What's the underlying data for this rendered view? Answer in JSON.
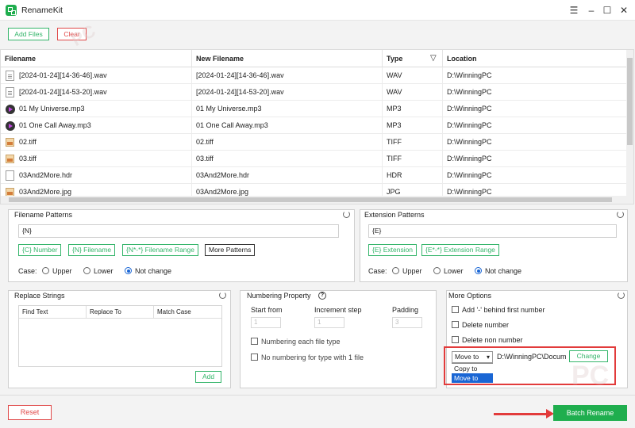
{
  "app": {
    "title": "RenameKit"
  },
  "toolbar": {
    "add_files": "Add Files",
    "clear": "Clear"
  },
  "table": {
    "columns": [
      "Filename",
      "New Filename",
      "Type",
      "Location"
    ],
    "rows": [
      {
        "filename": "[2024-01-24][14-36-46].wav",
        "new": "[2024-01-24][14-36-46].wav",
        "type": "WAV",
        "location": "D:\\WinningPC",
        "icon": "document-icon"
      },
      {
        "filename": "[2024-01-24][14-53-20].wav",
        "new": "[2024-01-24][14-53-20].wav",
        "type": "WAV",
        "location": "D:\\WinningPC",
        "icon": "document-icon"
      },
      {
        "filename": "01 My Universe.mp3",
        "new": "01 My Universe.mp3",
        "type": "MP3",
        "location": "D:\\WinningPC",
        "icon": "music-icon"
      },
      {
        "filename": "01 One Call Away.mp3",
        "new": "01 One Call Away.mp3",
        "type": "MP3",
        "location": "D:\\WinningPC",
        "icon": "music-icon"
      },
      {
        "filename": "02.tiff",
        "new": "02.tiff",
        "type": "TIFF",
        "location": "D:\\WinningPC",
        "icon": "image-icon"
      },
      {
        "filename": "03.tiff",
        "new": "03.tiff",
        "type": "TIFF",
        "location": "D:\\WinningPC",
        "icon": "image-icon"
      },
      {
        "filename": "03And2More.hdr",
        "new": "03And2More.hdr",
        "type": "HDR",
        "location": "D:\\WinningPC",
        "icon": "file-icon"
      },
      {
        "filename": "03And2More.jpg",
        "new": "03And2More.jpg",
        "type": "JPG",
        "location": "D:\\WinningPC",
        "icon": "image-icon"
      }
    ]
  },
  "filename_patterns": {
    "title": "Filename Patterns",
    "value": "{N}",
    "tags": [
      "{C} Number",
      "{N} Filename",
      "{N*-*} Filename Range",
      "More Patterns"
    ],
    "case_label": "Case:",
    "case_options": [
      "Upper",
      "Lower",
      "Not change"
    ],
    "case_selected": "Not change"
  },
  "extension_patterns": {
    "title": "Extension Patterns",
    "value": "{E}",
    "tags": [
      "{E} Extension",
      "{E*-*} Extension Range"
    ],
    "case_label": "Case:",
    "case_options": [
      "Upper",
      "Lower",
      "Not change"
    ],
    "case_selected": "Not change"
  },
  "replace_strings": {
    "title": "Replace Strings",
    "columns": [
      "Find Text",
      "Replace To",
      "Match Case"
    ],
    "add": "Add"
  },
  "numbering": {
    "title": "Numbering Property",
    "start_from_label": "Start from",
    "start_from": "1",
    "increment_label": "Increment step",
    "increment": "1",
    "padding_label": "Padding",
    "padding": "3",
    "each_type": "Numbering each file type",
    "no_numbering": "No numbering for type with 1 file"
  },
  "more_options": {
    "title": "More Options",
    "options": [
      "Add '-' behind first number",
      "Delete number",
      "Delete non number"
    ],
    "action_selected": "Move to",
    "action_options": [
      "Copy to",
      "Move to"
    ],
    "path": "D:\\WinningPC\\Docum",
    "change": "Change"
  },
  "footer": {
    "reset": "Reset",
    "batch_rename": "Batch Rename"
  },
  "colors": {
    "green": "#34b56a",
    "red": "#e04848",
    "blue": "#1a66d4",
    "highlight": "#e23b3b"
  }
}
